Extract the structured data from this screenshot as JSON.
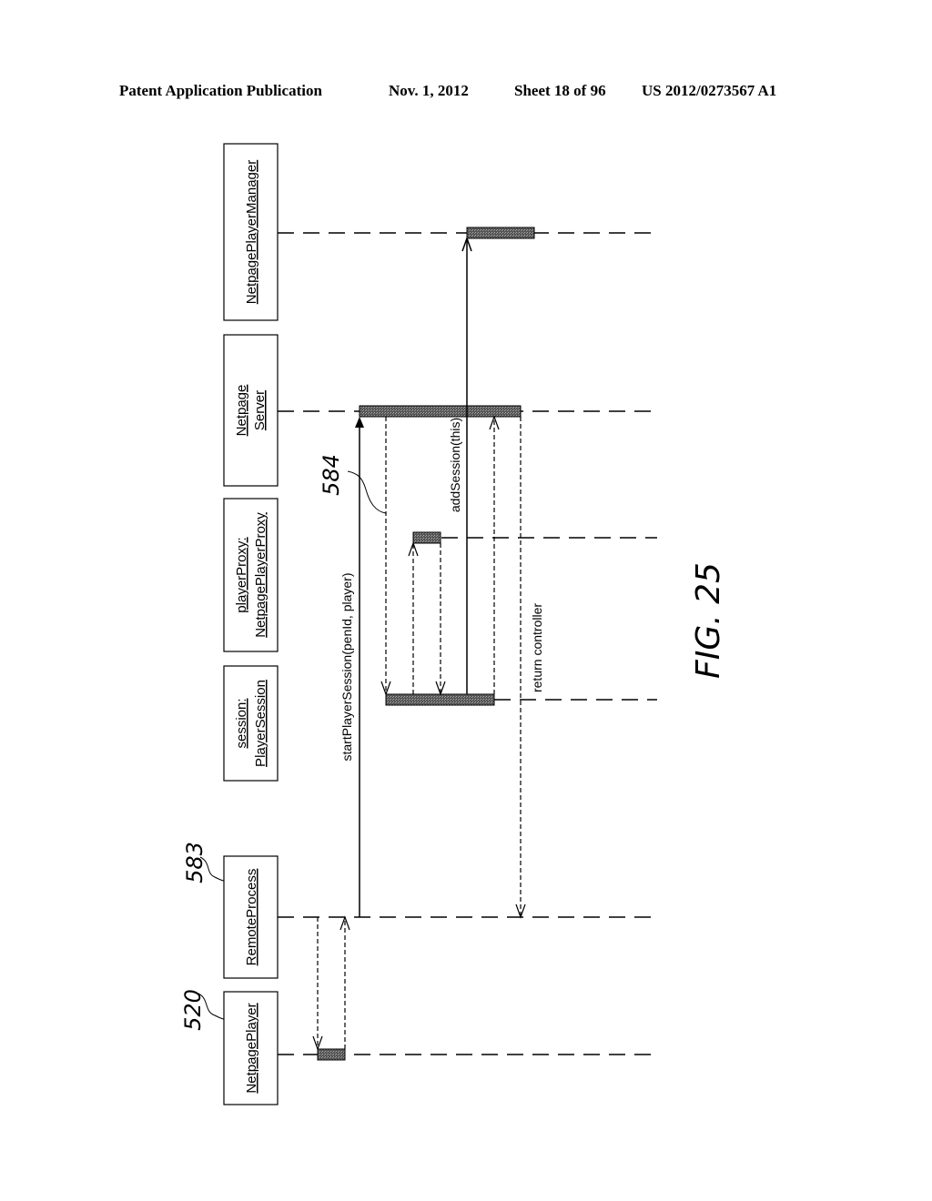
{
  "header": {
    "publication": "Patent Application Publication",
    "date": "Nov. 1, 2012",
    "sheet": "Sheet 18 of 96",
    "patent_number": "US 2012/0273567 A1"
  },
  "figure_label": "FIG. 25",
  "objects": [
    {
      "id": "netpage-player-manager",
      "lines": [
        "NetpagePlayerManager"
      ]
    },
    {
      "id": "netpage-server",
      "lines": [
        "Netpage",
        "Server"
      ]
    },
    {
      "id": "player-proxy",
      "lines": [
        "playerProxy:",
        "NetpagePlayerProxy"
      ]
    },
    {
      "id": "session",
      "lines": [
        "session:",
        "PlayerSession"
      ]
    },
    {
      "id": "remote-process",
      "lines": [
        "RemoteProcess"
      ],
      "ref": "583"
    },
    {
      "id": "netpage-player",
      "lines": [
        "NetpagePlayer"
      ],
      "ref": "520"
    }
  ],
  "messages": [
    {
      "label": "startPlayerSession(penId, player)",
      "from": "remote-process",
      "to": "netpage-server",
      "style": "solid"
    },
    {
      "label": "addSession(this)",
      "from": "session",
      "to": "netpage-player-manager",
      "style": "solid"
    },
    {
      "label": "return controller",
      "from": "netpage-server",
      "to": "remote-process",
      "style": "dashed"
    }
  ],
  "annotations": {
    "ref_584": "584"
  }
}
